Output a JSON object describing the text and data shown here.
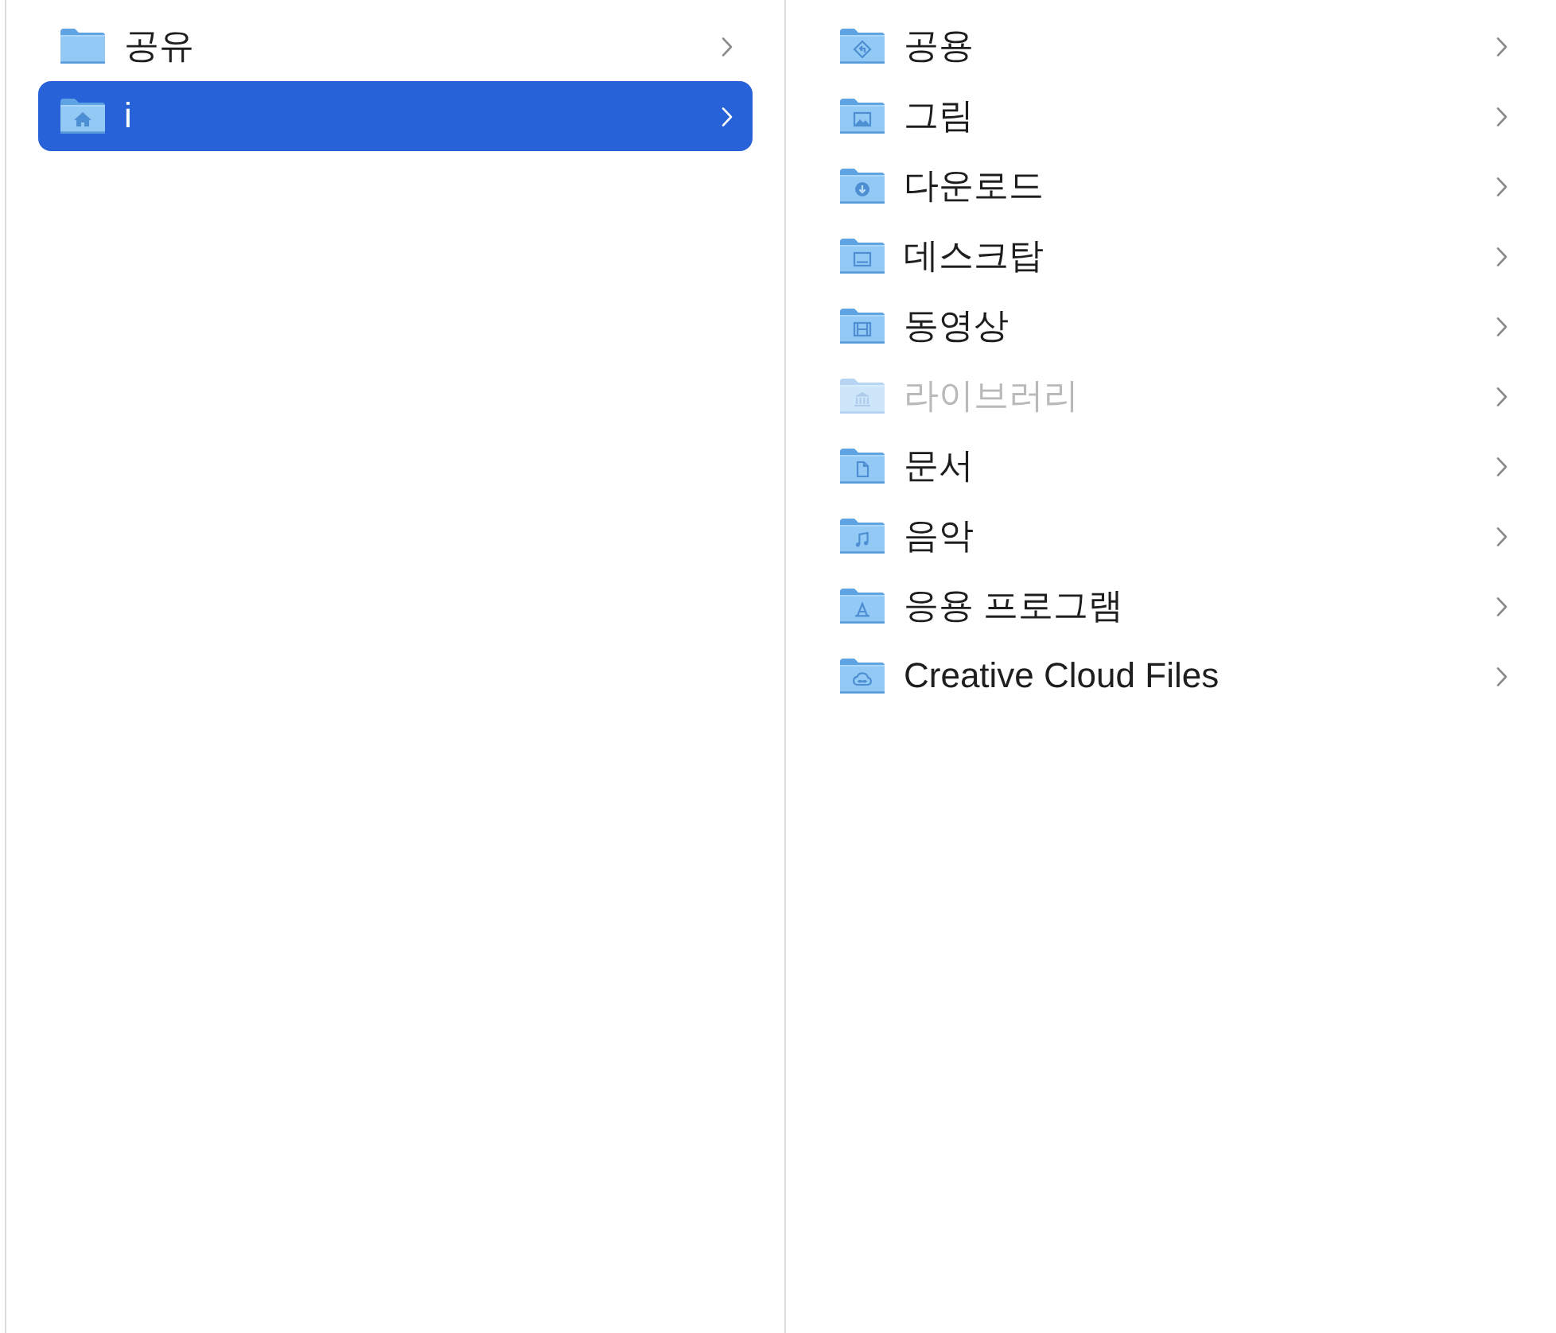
{
  "columns": [
    {
      "items": [
        {
          "name": "공유",
          "kind": "shared",
          "selected": false,
          "dimmed": false
        },
        {
          "name": "i",
          "kind": "home",
          "selected": true,
          "dimmed": false
        }
      ]
    },
    {
      "items": [
        {
          "name": "공용",
          "kind": "public",
          "selected": false,
          "dimmed": false
        },
        {
          "name": "그림",
          "kind": "pictures",
          "selected": false,
          "dimmed": false
        },
        {
          "name": "다운로드",
          "kind": "downloads",
          "selected": false,
          "dimmed": false
        },
        {
          "name": "데스크탑",
          "kind": "desktop",
          "selected": false,
          "dimmed": false
        },
        {
          "name": "동영상",
          "kind": "movies",
          "selected": false,
          "dimmed": false
        },
        {
          "name": "라이브러리",
          "kind": "library",
          "selected": false,
          "dimmed": true
        },
        {
          "name": "문서",
          "kind": "documents",
          "selected": false,
          "dimmed": false
        },
        {
          "name": "음악",
          "kind": "music",
          "selected": false,
          "dimmed": false
        },
        {
          "name": "응용 프로그램",
          "kind": "applications",
          "selected": false,
          "dimmed": false
        },
        {
          "name": "Creative Cloud Files",
          "kind": "creative-cloud",
          "selected": false,
          "dimmed": false
        }
      ]
    }
  ]
}
